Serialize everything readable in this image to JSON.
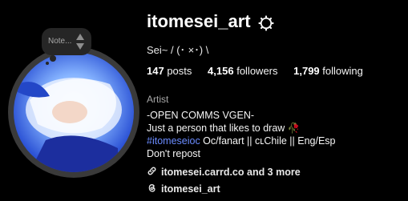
{
  "profile": {
    "username": "itomesei_art",
    "pronouns": "Sei~ / (･ ×･) \\",
    "stats": {
      "posts_count": "147",
      "posts_label": "posts",
      "followers_count": "4,156",
      "followers_label": "followers",
      "following_count": "1,799",
      "following_label": "following"
    },
    "category": "Artist",
    "bio": {
      "line1": "-OPEN COMMS VGEN-",
      "line2": "Just a person that likes to draw 🥀",
      "hashtag": "#itomeseioc",
      "line3_rest": " Oc/fanart || cʟChile || Eng/Esp",
      "line4": "Don't repost"
    },
    "link": {
      "icon": "link-icon",
      "text": "itomesei.carrd.co and 3 more"
    },
    "threads": {
      "icon": "threads-icon",
      "text": "itomesei_art"
    }
  },
  "note": {
    "text": "Note...",
    "icon": "up-down-arrows-icon"
  },
  "settings": {
    "icon": "gear-icon"
  },
  "avatar": {
    "icon": "avatar"
  },
  "colors": {
    "background": "#000000",
    "text": "#f5f5f5",
    "secondary": "#a8a8a8",
    "hashtag": "#6b8cff"
  }
}
